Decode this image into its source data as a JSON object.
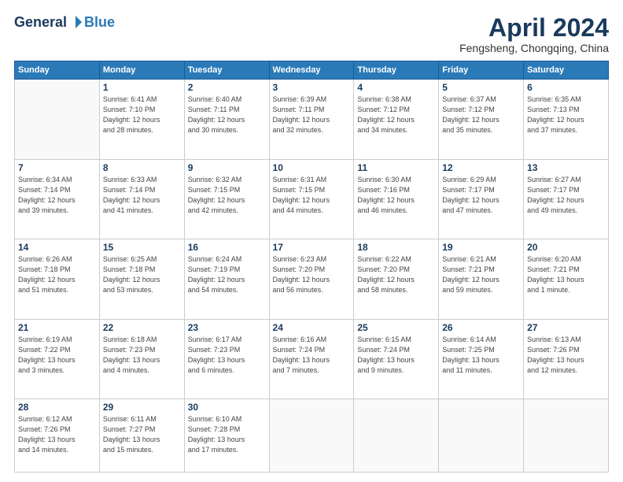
{
  "header": {
    "logo_general": "General",
    "logo_blue": "Blue",
    "month_title": "April 2024",
    "subtitle": "Fengsheng, Chongqing, China"
  },
  "weekdays": [
    "Sunday",
    "Monday",
    "Tuesday",
    "Wednesday",
    "Thursday",
    "Friday",
    "Saturday"
  ],
  "weeks": [
    [
      {
        "day": "",
        "info": ""
      },
      {
        "day": "1",
        "info": "Sunrise: 6:41 AM\nSunset: 7:10 PM\nDaylight: 12 hours\nand 28 minutes."
      },
      {
        "day": "2",
        "info": "Sunrise: 6:40 AM\nSunset: 7:11 PM\nDaylight: 12 hours\nand 30 minutes."
      },
      {
        "day": "3",
        "info": "Sunrise: 6:39 AM\nSunset: 7:11 PM\nDaylight: 12 hours\nand 32 minutes."
      },
      {
        "day": "4",
        "info": "Sunrise: 6:38 AM\nSunset: 7:12 PM\nDaylight: 12 hours\nand 34 minutes."
      },
      {
        "day": "5",
        "info": "Sunrise: 6:37 AM\nSunset: 7:12 PM\nDaylight: 12 hours\nand 35 minutes."
      },
      {
        "day": "6",
        "info": "Sunrise: 6:35 AM\nSunset: 7:13 PM\nDaylight: 12 hours\nand 37 minutes."
      }
    ],
    [
      {
        "day": "7",
        "info": "Sunrise: 6:34 AM\nSunset: 7:14 PM\nDaylight: 12 hours\nand 39 minutes."
      },
      {
        "day": "8",
        "info": "Sunrise: 6:33 AM\nSunset: 7:14 PM\nDaylight: 12 hours\nand 41 minutes."
      },
      {
        "day": "9",
        "info": "Sunrise: 6:32 AM\nSunset: 7:15 PM\nDaylight: 12 hours\nand 42 minutes."
      },
      {
        "day": "10",
        "info": "Sunrise: 6:31 AM\nSunset: 7:15 PM\nDaylight: 12 hours\nand 44 minutes."
      },
      {
        "day": "11",
        "info": "Sunrise: 6:30 AM\nSunset: 7:16 PM\nDaylight: 12 hours\nand 46 minutes."
      },
      {
        "day": "12",
        "info": "Sunrise: 6:29 AM\nSunset: 7:17 PM\nDaylight: 12 hours\nand 47 minutes."
      },
      {
        "day": "13",
        "info": "Sunrise: 6:27 AM\nSunset: 7:17 PM\nDaylight: 12 hours\nand 49 minutes."
      }
    ],
    [
      {
        "day": "14",
        "info": "Sunrise: 6:26 AM\nSunset: 7:18 PM\nDaylight: 12 hours\nand 51 minutes."
      },
      {
        "day": "15",
        "info": "Sunrise: 6:25 AM\nSunset: 7:18 PM\nDaylight: 12 hours\nand 53 minutes."
      },
      {
        "day": "16",
        "info": "Sunrise: 6:24 AM\nSunset: 7:19 PM\nDaylight: 12 hours\nand 54 minutes."
      },
      {
        "day": "17",
        "info": "Sunrise: 6:23 AM\nSunset: 7:20 PM\nDaylight: 12 hours\nand 56 minutes."
      },
      {
        "day": "18",
        "info": "Sunrise: 6:22 AM\nSunset: 7:20 PM\nDaylight: 12 hours\nand 58 minutes."
      },
      {
        "day": "19",
        "info": "Sunrise: 6:21 AM\nSunset: 7:21 PM\nDaylight: 12 hours\nand 59 minutes."
      },
      {
        "day": "20",
        "info": "Sunrise: 6:20 AM\nSunset: 7:21 PM\nDaylight: 13 hours\nand 1 minute."
      }
    ],
    [
      {
        "day": "21",
        "info": "Sunrise: 6:19 AM\nSunset: 7:22 PM\nDaylight: 13 hours\nand 3 minutes."
      },
      {
        "day": "22",
        "info": "Sunrise: 6:18 AM\nSunset: 7:23 PM\nDaylight: 13 hours\nand 4 minutes."
      },
      {
        "day": "23",
        "info": "Sunrise: 6:17 AM\nSunset: 7:23 PM\nDaylight: 13 hours\nand 6 minutes."
      },
      {
        "day": "24",
        "info": "Sunrise: 6:16 AM\nSunset: 7:24 PM\nDaylight: 13 hours\nand 7 minutes."
      },
      {
        "day": "25",
        "info": "Sunrise: 6:15 AM\nSunset: 7:24 PM\nDaylight: 13 hours\nand 9 minutes."
      },
      {
        "day": "26",
        "info": "Sunrise: 6:14 AM\nSunset: 7:25 PM\nDaylight: 13 hours\nand 11 minutes."
      },
      {
        "day": "27",
        "info": "Sunrise: 6:13 AM\nSunset: 7:26 PM\nDaylight: 13 hours\nand 12 minutes."
      }
    ],
    [
      {
        "day": "28",
        "info": "Sunrise: 6:12 AM\nSunset: 7:26 PM\nDaylight: 13 hours\nand 14 minutes."
      },
      {
        "day": "29",
        "info": "Sunrise: 6:11 AM\nSunset: 7:27 PM\nDaylight: 13 hours\nand 15 minutes."
      },
      {
        "day": "30",
        "info": "Sunrise: 6:10 AM\nSunset: 7:28 PM\nDaylight: 13 hours\nand 17 minutes."
      },
      {
        "day": "",
        "info": ""
      },
      {
        "day": "",
        "info": ""
      },
      {
        "day": "",
        "info": ""
      },
      {
        "day": "",
        "info": ""
      }
    ]
  ]
}
